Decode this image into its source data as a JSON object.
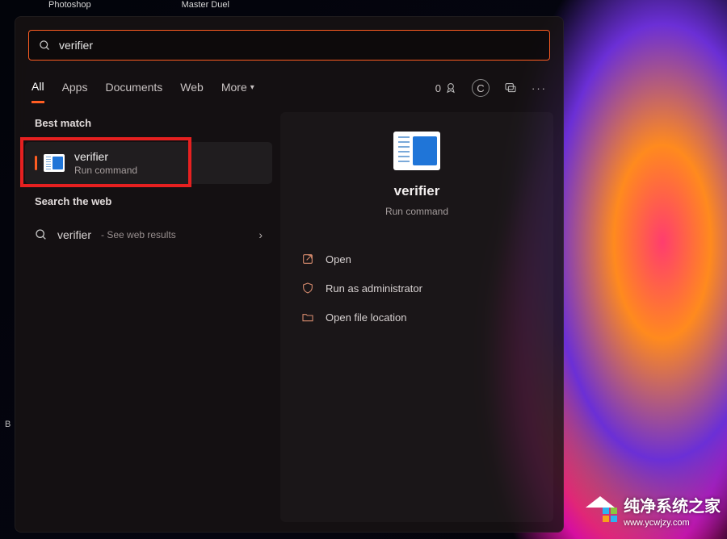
{
  "desktop": {
    "icon1": "Photoshop",
    "icon2": "Master Duel",
    "cutoffText": "B"
  },
  "search": {
    "query": "verifier"
  },
  "tabs": {
    "items": [
      {
        "label": "All",
        "active": true
      },
      {
        "label": "Apps"
      },
      {
        "label": "Documents"
      },
      {
        "label": "Web"
      },
      {
        "label": "More",
        "dropdown": true
      }
    ]
  },
  "header": {
    "points": "0",
    "profileInitial": "C"
  },
  "bestMatch": {
    "sectionLabel": "Best match",
    "title": "verifier",
    "subtitle": "Run command"
  },
  "webSearch": {
    "sectionLabel": "Search the web",
    "term": "verifier",
    "detail": " - See web results"
  },
  "detail": {
    "title": "verifier",
    "subtitle": "Run command",
    "actions": {
      "open": "Open",
      "admin": "Run as administrator",
      "location": "Open file location"
    }
  },
  "watermark": {
    "text": "纯净系统之家",
    "url": "www.ycwjzy.com"
  }
}
